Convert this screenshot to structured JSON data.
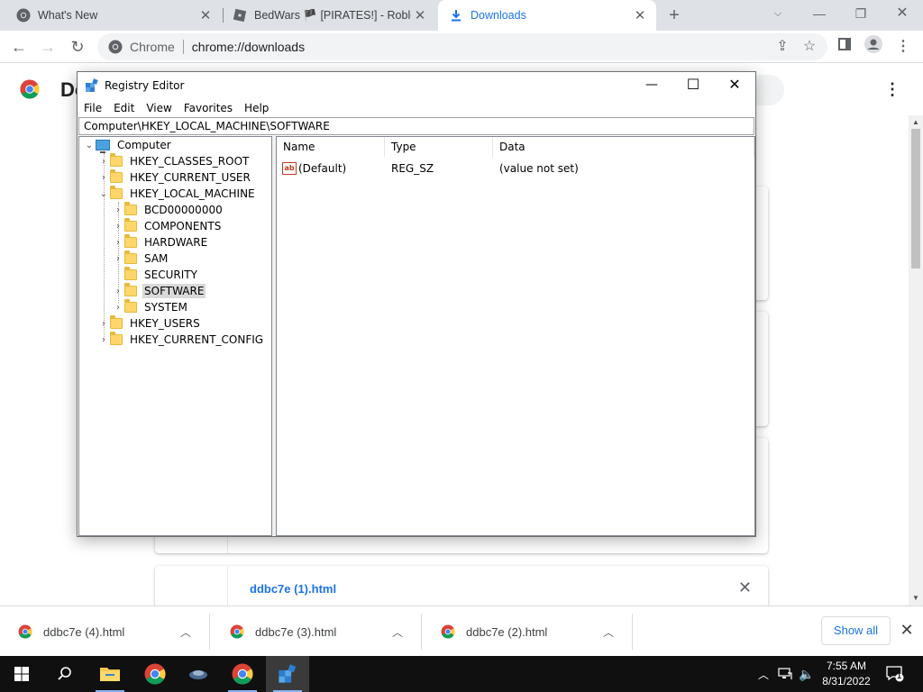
{
  "browser": {
    "tabs": [
      {
        "title": "What's New",
        "icon": "chrome-icon",
        "active": false
      },
      {
        "title": "BedWars 🏴 [PIRATES!] - Roblox",
        "icon": "roblox-icon",
        "active": false
      },
      {
        "title": "Downloads",
        "icon": "download-icon",
        "active": true
      }
    ],
    "omnibox": {
      "site": "Chrome",
      "url": "chrome://downloads"
    }
  },
  "downloads_page": {
    "title": "Do",
    "cards": [
      {
        "filename": "ddbc7e (1).html"
      }
    ]
  },
  "registry_editor": {
    "title": "Registry Editor",
    "menu": [
      "File",
      "Edit",
      "View",
      "Favorites",
      "Help"
    ],
    "address": "Computer\\HKEY_LOCAL_MACHINE\\SOFTWARE",
    "tree": {
      "root": "Computer",
      "hives": [
        "HKEY_CLASSES_ROOT",
        "HKEY_CURRENT_USER",
        "HKEY_LOCAL_MACHINE",
        "HKEY_USERS",
        "HKEY_CURRENT_CONFIG"
      ],
      "hklm_children": [
        "BCD00000000",
        "COMPONENTS",
        "HARDWARE",
        "SAM",
        "SECURITY",
        "SOFTWARE",
        "SYSTEM"
      ],
      "selected": "SOFTWARE"
    },
    "list": {
      "columns": [
        "Name",
        "Type",
        "Data"
      ],
      "rows": [
        {
          "name": "(Default)",
          "type": "REG_SZ",
          "data": "(value not set)"
        }
      ]
    }
  },
  "shelf": {
    "items": [
      "ddbc7e (4).html",
      "ddbc7e (3).html",
      "ddbc7e (2).html"
    ],
    "show_all": "Show all"
  },
  "taskbar": {
    "time": "7:55 AM",
    "date": "8/31/2022",
    "notification_count": "1"
  }
}
